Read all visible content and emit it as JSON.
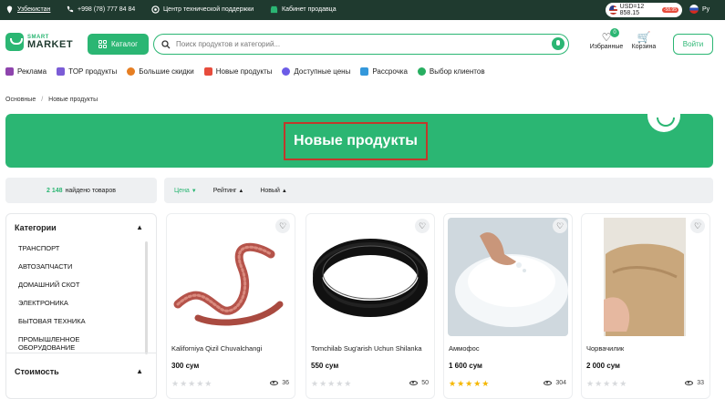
{
  "topbar": {
    "region": "Узбекистан",
    "phone": "+998 (78) 777 84 84",
    "support": "Центр технической поддержки",
    "seller": "Кабинет продавца",
    "currency": "USD=12 858.15",
    "currency_delta": "-58.95",
    "language": "Ру"
  },
  "header": {
    "logo_small": "SMART",
    "logo_big": "MARKET",
    "catalog_label": "Каталог",
    "search_placeholder": "Поиск продуктов и категорий...",
    "favorites_label": "Избранные",
    "favorites_count": "0",
    "cart_label": "Корзина",
    "login_label": "Войти"
  },
  "nav": [
    {
      "label": "Реклама",
      "color": "#8e44ad"
    },
    {
      "label": "TOP продукты",
      "color": "#7b5cd6"
    },
    {
      "label": "Большие скидки",
      "color": "#e67e22"
    },
    {
      "label": "Новые продукты",
      "color": "#e74c3c"
    },
    {
      "label": "Доступные цены",
      "color": "#6c5ce7"
    },
    {
      "label": "Рассрочка",
      "color": "#3498db"
    },
    {
      "label": "Выбор клиентов",
      "color": "#27ae60"
    }
  ],
  "breadcrumb": {
    "home": "Основные",
    "separator": "/",
    "current": "Новые продукты"
  },
  "banner": {
    "title": "Новые продукты"
  },
  "results": {
    "count": "2 148",
    "text": "найдено товаров"
  },
  "sort": {
    "price": "Цена",
    "rating": "Рейтинг",
    "new": "Новый"
  },
  "sidebar": {
    "categories_title": "Категории",
    "categories": [
      "ТРАНСПОРТ",
      "АВТОЗАПЧАСТИ",
      "ДОМАШНИЙ СКОТ",
      "ЭЛЕКТРОНИКА",
      "БЫТОВАЯ ТЕХНИКА",
      "ПРОМЫШЛЕННОЕ ОБОРУДОВАНИЕ"
    ],
    "price_title": "Стоимость"
  },
  "products": [
    {
      "name": "Kaliforniya Qizil Chuvalchangi",
      "price": "300 сум",
      "views": "36",
      "rating": 0
    },
    {
      "name": "Tomchilab Sug'arish Uchun Shilanka",
      "price": "550 сум",
      "views": "50",
      "rating": 0
    },
    {
      "name": "Аммофос",
      "price": "1 600 сум",
      "views": "304",
      "rating": 5
    },
    {
      "name": "Чорвачилик",
      "price": "2 000 сум",
      "views": "33",
      "rating": 0
    }
  ],
  "colors": {
    "brand": "#2bb673",
    "dark": "#1f3a2f",
    "star": "#f5b700"
  }
}
